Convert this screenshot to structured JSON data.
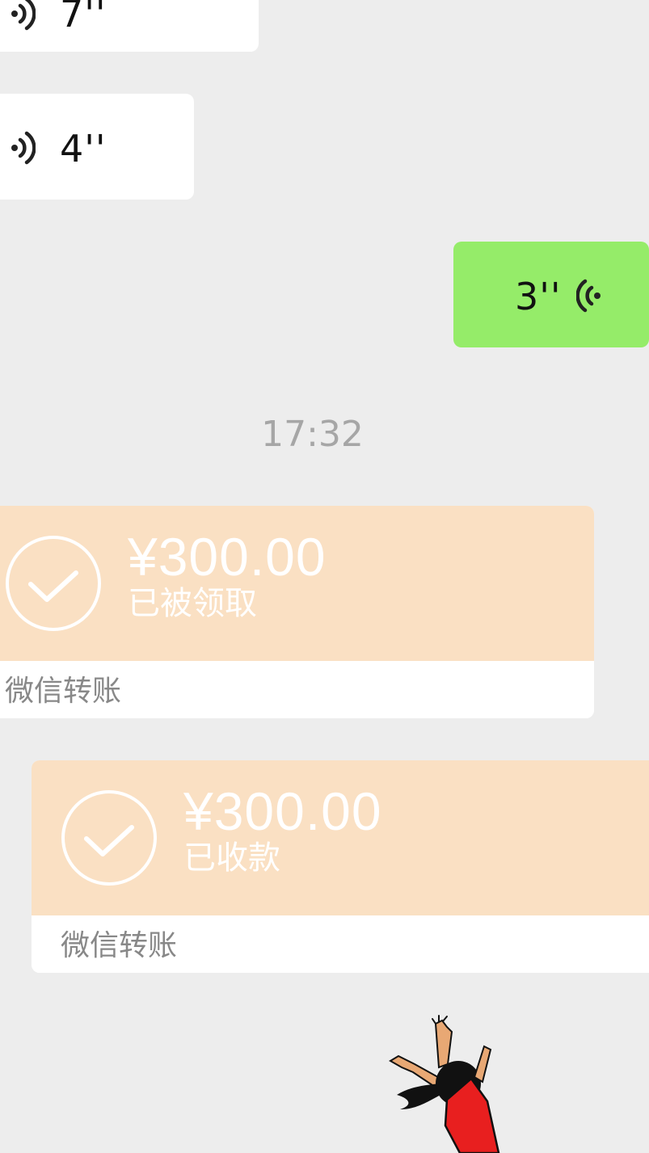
{
  "chat": {
    "messages": [
      {
        "type": "voice",
        "direction": "incoming",
        "duration": "7''"
      },
      {
        "type": "voice",
        "direction": "incoming",
        "duration": "4''"
      },
      {
        "type": "voice",
        "direction": "outgoing",
        "duration": "3''"
      }
    ],
    "timestamp": "17:32",
    "transfers": [
      {
        "direction": "incoming",
        "amount": "¥300.00",
        "status": "已被领取",
        "source": "微信转账",
        "icon": "check-circle-icon"
      },
      {
        "direction": "outgoing",
        "amount": "¥300.00",
        "status": "已收款",
        "source": "微信转账",
        "icon": "check-circle-icon"
      }
    ],
    "sticker": {
      "icon": "cartoon-girl-sticker"
    }
  },
  "colors": {
    "background": "#ededed",
    "incoming_bubble": "#ffffff",
    "outgoing_bubble": "#95ec69",
    "transfer_card": "#fae0c3",
    "timestamp": "#a6a6a6"
  }
}
